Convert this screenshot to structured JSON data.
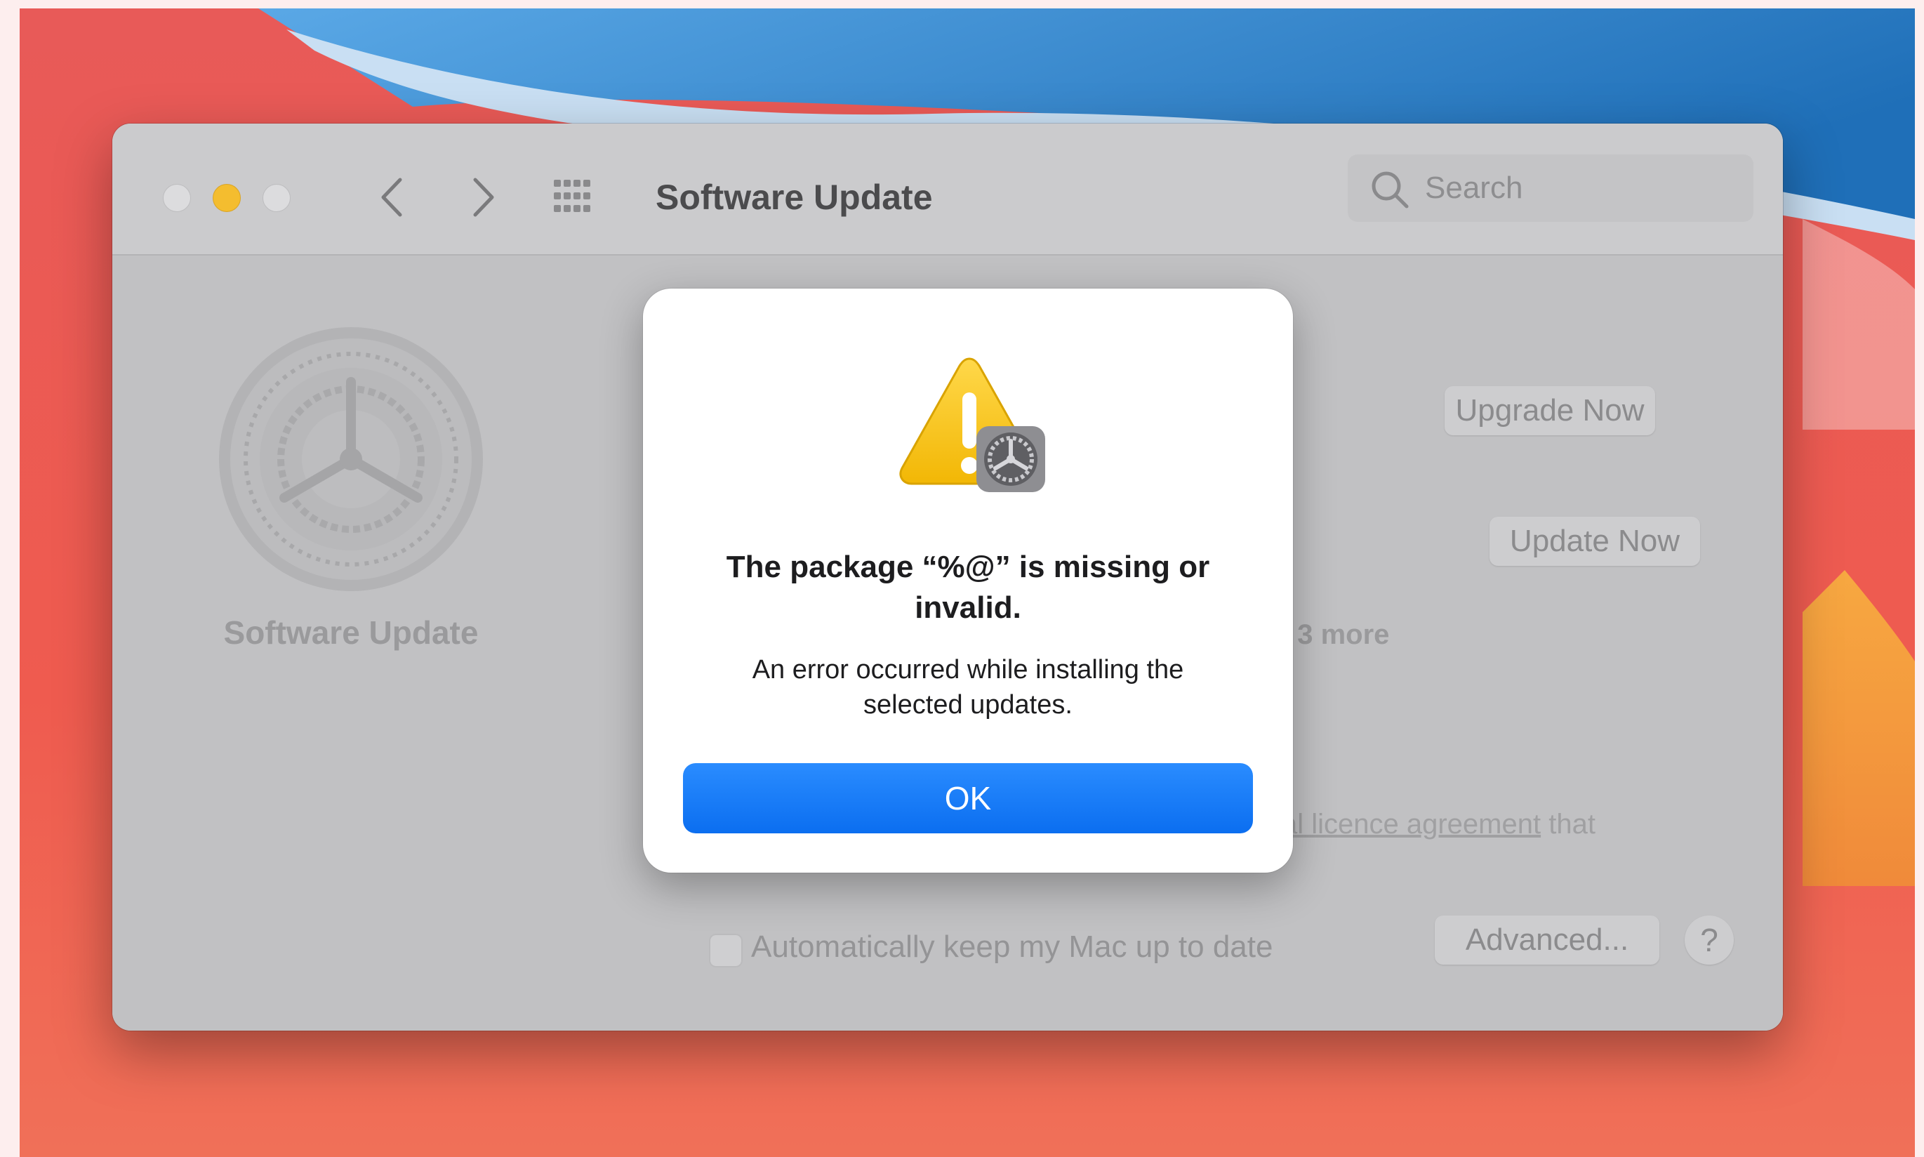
{
  "window": {
    "title": "Software Update",
    "search_placeholder": "Search"
  },
  "sidebar": {
    "label": "Software Update"
  },
  "pane": {
    "upgrade_button": "Upgrade Now",
    "update_button": "Update Now",
    "more_text": "l 3 more",
    "licence_link": "al licence agreement",
    "licence_suffix": " that",
    "auto_update_label": "Automatically keep my Mac up to date",
    "advanced_button": "Advanced...",
    "help_button": "?"
  },
  "dialog": {
    "title": "The package “%@” is missing or invalid.",
    "message": "An error occurred while installing the selected updates.",
    "ok_button": "OK"
  },
  "colors": {
    "accent": "#0b6ef0",
    "minimize_light": "#f4bd2f"
  },
  "icons": [
    "back-chevron-icon",
    "forward-chevron-icon",
    "grid-icon",
    "search-icon",
    "gear-icon",
    "warning-icon"
  ]
}
